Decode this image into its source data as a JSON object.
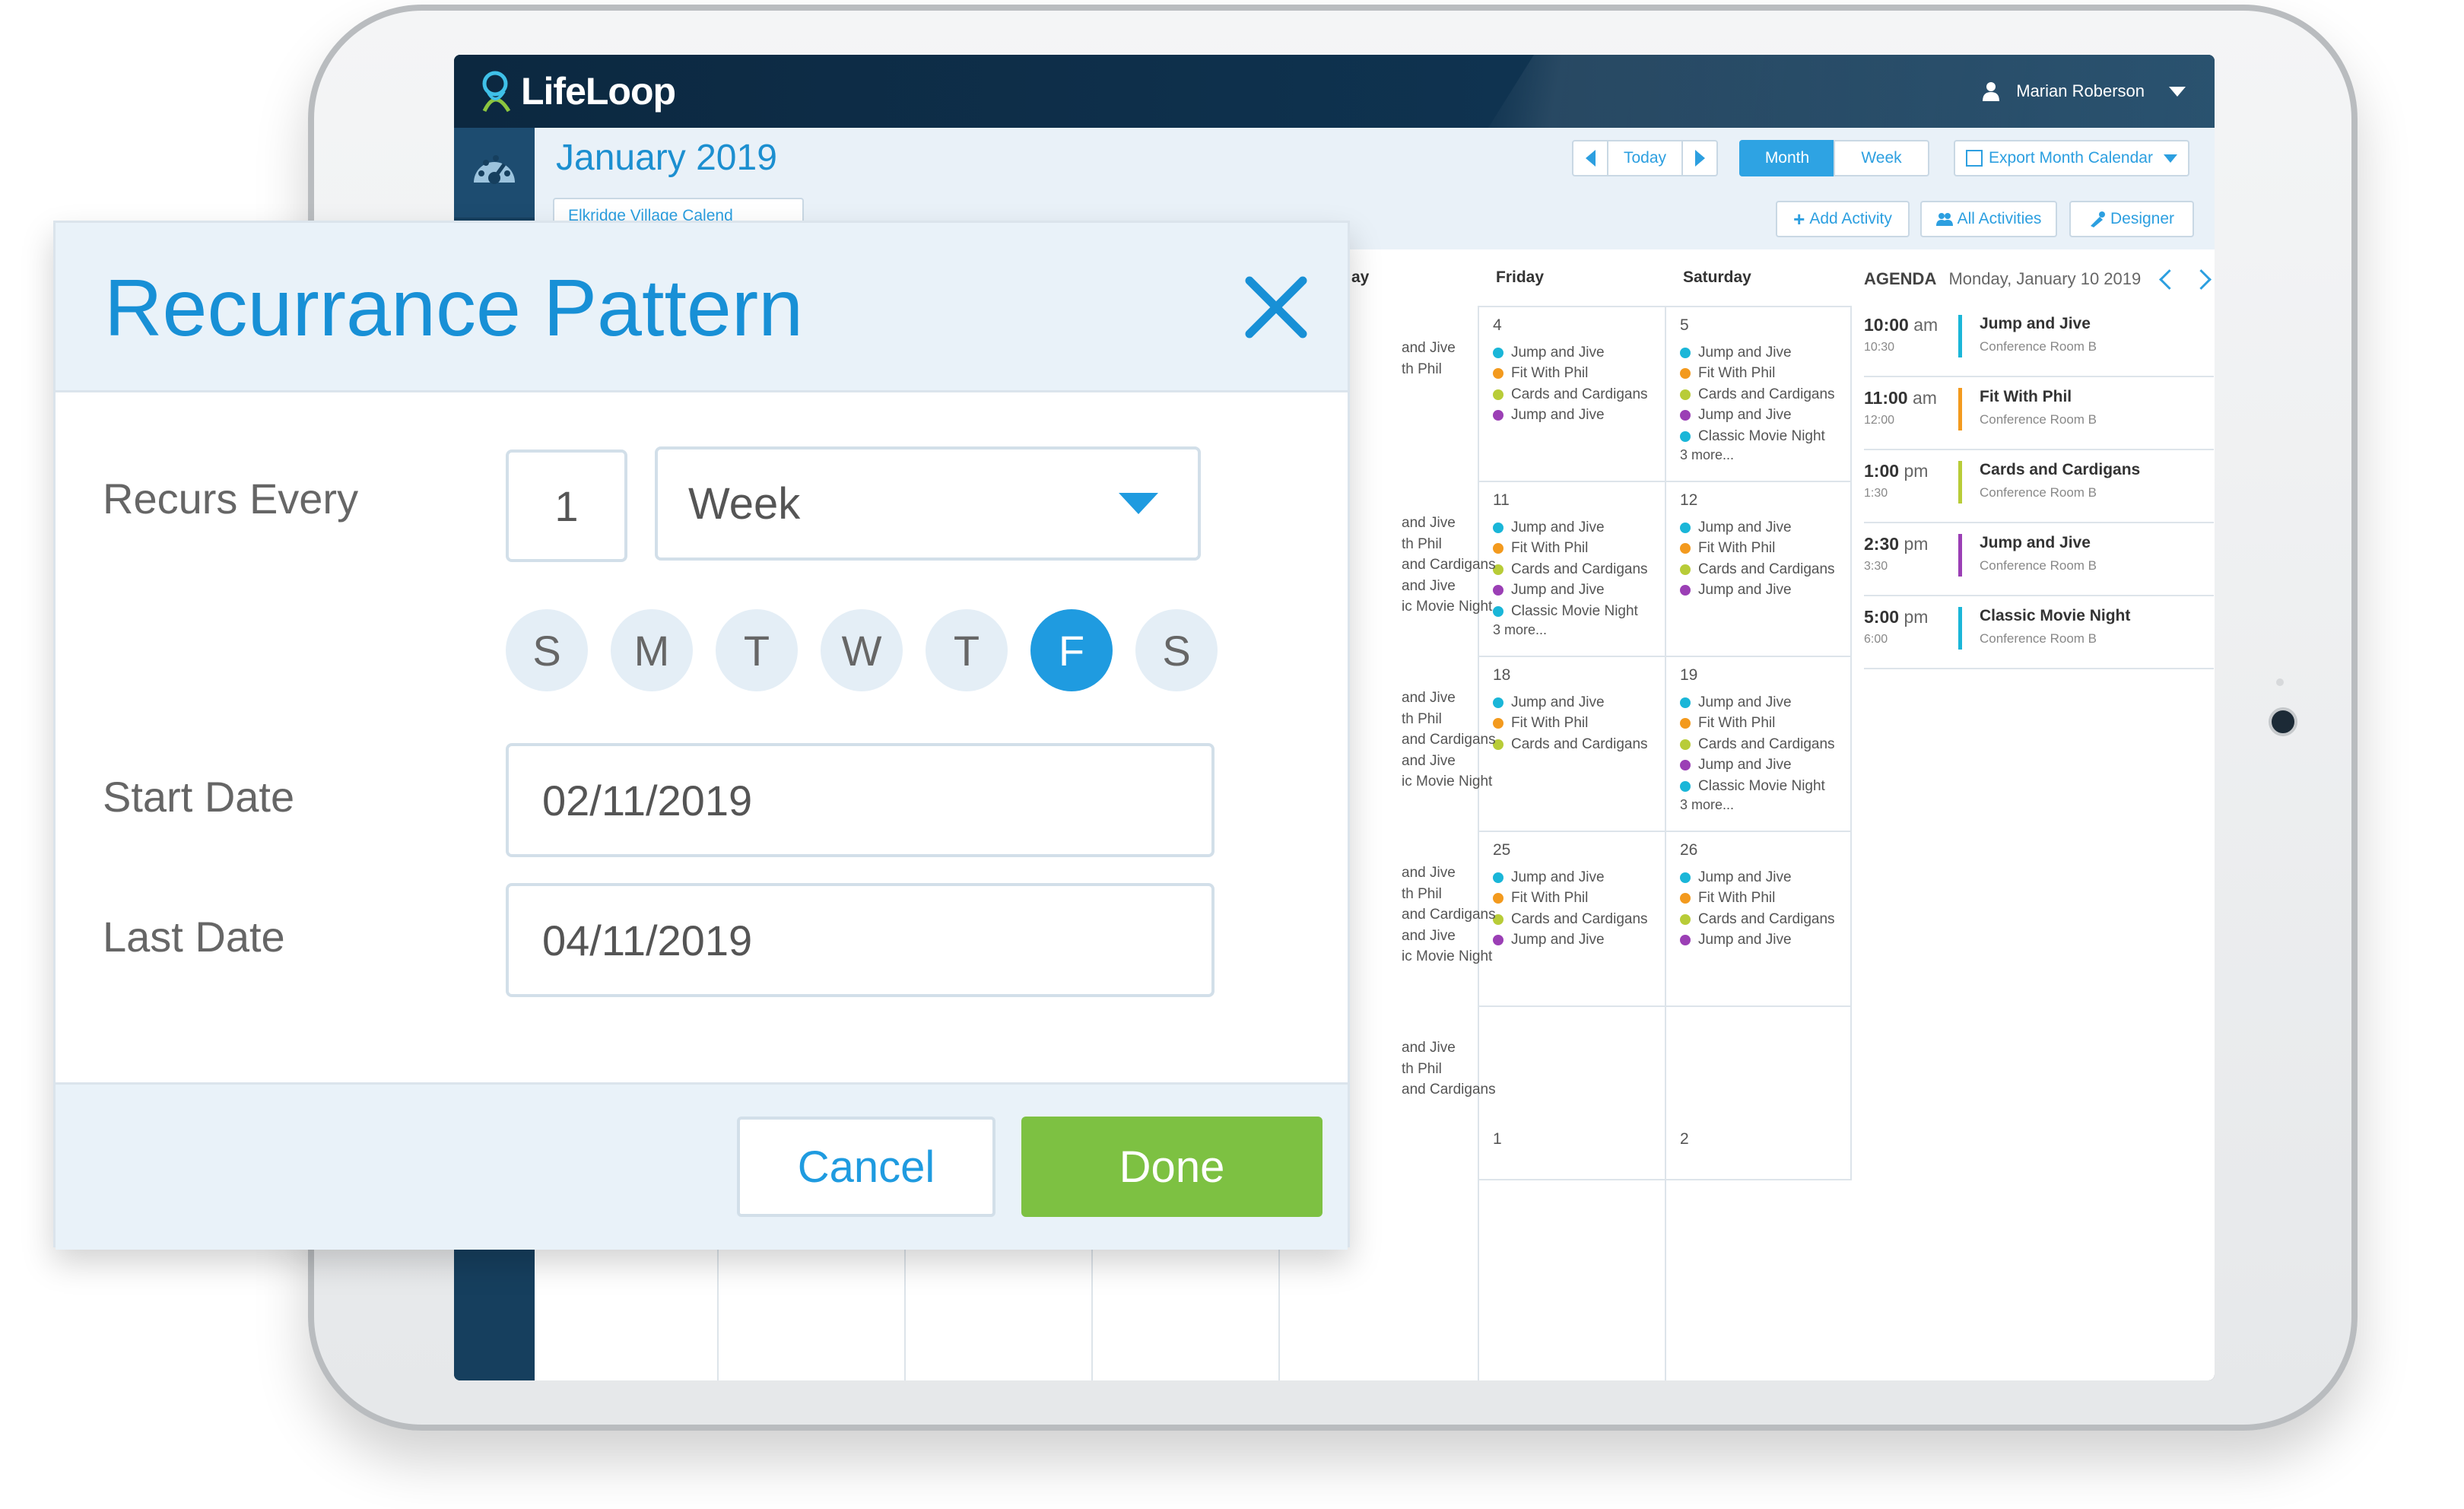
{
  "app": {
    "brand": "LifeLoop",
    "user_name": "Marian Roberson"
  },
  "calendar": {
    "title": "January 2019",
    "today_label": "Today",
    "view_month": "Month",
    "view_week": "Week",
    "export_label": "Export Month Calendar",
    "calendar_select": "Elkridge Village Calend",
    "add_activity": "Add Activity",
    "all_activities": "All Activities",
    "designer": "Designer",
    "day_headers": [
      "ay",
      "Friday",
      "Saturday"
    ],
    "partial_column": [
      [
        "and Jive",
        "th Phil"
      ],
      [
        "and Jive",
        "th Phil",
        "and Cardigans",
        "and Jive",
        "ic Movie Night"
      ],
      [
        "and Jive",
        "th Phil",
        "and Cardigans",
        "and Jive",
        "ic Movie Night"
      ],
      [
        "and Jive",
        "th Phil",
        "and Cardigans",
        "and Jive",
        "ic Movie Night"
      ],
      [
        "and Jive",
        "th Phil",
        "and Cardigans"
      ]
    ],
    "friday": [
      {
        "date": "4",
        "events": [
          "Jump and Jive",
          "Fit With Phil",
          "Cards and Cardigans",
          "Jump and Jive"
        ],
        "colors": [
          "#1ab6d8",
          "#f39a1e",
          "#b8cc38",
          "#9b3fb5"
        ],
        "more": ""
      },
      {
        "date": "11",
        "events": [
          "Jump and Jive",
          "Fit With Phil",
          "Cards and Cardigans",
          "Jump and Jive",
          "Classic Movie Night"
        ],
        "colors": [
          "#1ab6d8",
          "#f39a1e",
          "#b8cc38",
          "#9b3fb5",
          "#1ab6d8"
        ],
        "more": "3 more..."
      },
      {
        "date": "18",
        "events": [
          "Jump and Jive",
          "Fit With Phil",
          "Cards and Cardigans"
        ],
        "colors": [
          "#1ab6d8",
          "#f39a1e",
          "#b8cc38"
        ],
        "more": ""
      },
      {
        "date": "25",
        "events": [
          "Jump and Jive",
          "Fit With Phil",
          "Cards and Cardigans",
          "Jump and Jive"
        ],
        "colors": [
          "#1ab6d8",
          "#f39a1e",
          "#b8cc38",
          "#9b3fb5"
        ],
        "more": ""
      },
      {
        "date": "1",
        "events": [],
        "colors": [],
        "more": ""
      }
    ],
    "saturday": [
      {
        "date": "5",
        "events": [
          "Jump and Jive",
          "Fit With Phil",
          "Cards and Cardigans",
          "Jump and Jive",
          "Classic Movie Night"
        ],
        "colors": [
          "#1ab6d8",
          "#f39a1e",
          "#b8cc38",
          "#9b3fb5",
          "#1ab6d8"
        ],
        "more": "3 more..."
      },
      {
        "date": "12",
        "events": [
          "Jump and Jive",
          "Fit With Phil",
          "Cards and Cardigans",
          "Jump and Jive"
        ],
        "colors": [
          "#1ab6d8",
          "#f39a1e",
          "#b8cc38",
          "#9b3fb5"
        ],
        "more": ""
      },
      {
        "date": "19",
        "events": [
          "Jump and Jive",
          "Fit With Phil",
          "Cards and Cardigans",
          "Jump and Jive",
          "Classic Movie Night"
        ],
        "colors": [
          "#1ab6d8",
          "#f39a1e",
          "#b8cc38",
          "#9b3fb5",
          "#1ab6d8"
        ],
        "more": "3 more..."
      },
      {
        "date": "26",
        "events": [
          "Jump and Jive",
          "Fit With Phil",
          "Cards and Cardigans",
          "Jump and Jive"
        ],
        "colors": [
          "#1ab6d8",
          "#f39a1e",
          "#b8cc38",
          "#9b3fb5"
        ],
        "more": ""
      },
      {
        "date": "2",
        "events": [],
        "colors": [],
        "more": ""
      }
    ]
  },
  "agenda": {
    "label": "AGENDA",
    "date": "Monday, January 10 2019",
    "items": [
      {
        "time": "10:00",
        "ampm": "am",
        "end": "10:30",
        "name": "Jump and Jive",
        "room": "Conference Room B",
        "color": "#1ab6d8"
      },
      {
        "time": "11:00",
        "ampm": "am",
        "end": "12:00",
        "name": "Fit With Phil",
        "room": "Conference Room B",
        "color": "#f39a1e"
      },
      {
        "time": "1:00",
        "ampm": "pm",
        "end": "1:30",
        "name": "Cards and Cardigans",
        "room": "Conference Room B",
        "color": "#b8cc38"
      },
      {
        "time": "2:30",
        "ampm": "pm",
        "end": "3:30",
        "name": "Jump and Jive",
        "room": "Conference Room B",
        "color": "#9b3fb5"
      },
      {
        "time": "5:00",
        "ampm": "pm",
        "end": "6:00",
        "name": "Classic Movie Night",
        "room": "Conference Room B",
        "color": "#1ab6d8"
      }
    ]
  },
  "modal": {
    "title": "Recurrance Pattern",
    "recurs_label": "Recurs Every",
    "interval_value": "1",
    "unit_value": "Week",
    "days": [
      "S",
      "M",
      "T",
      "W",
      "T",
      "F",
      "S"
    ],
    "selected_day_index": 5,
    "start_label": "Start Date",
    "start_value": "02/11/2019",
    "last_label": "Last Date",
    "last_value": "04/11/2019",
    "cancel_label": "Cancel",
    "done_label": "Done"
  },
  "colors": {
    "accent": "#1f9be0",
    "done": "#7dc142",
    "brand_bar": "#0c2840"
  }
}
